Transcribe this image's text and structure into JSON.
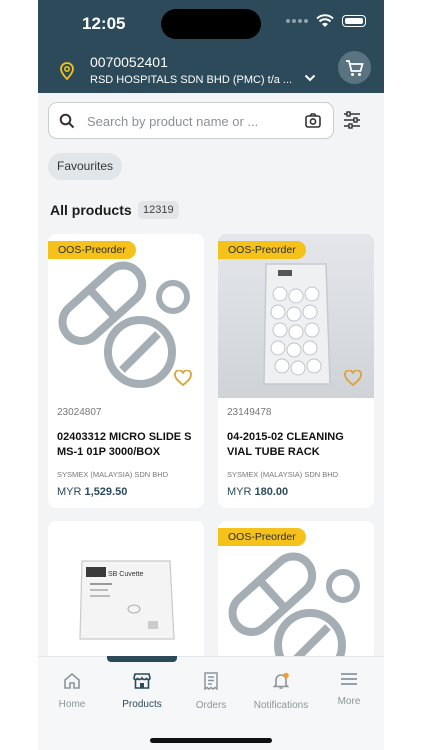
{
  "status_bar": {
    "time": "12:05"
  },
  "account": {
    "number": "0070052401",
    "name": "RSD HOSPITALS SDN BHD (PMC)  t/a ..."
  },
  "search": {
    "placeholder": "Search by product name or ..."
  },
  "filters": {
    "favourites_label": "Favourites"
  },
  "products": {
    "heading": "All products",
    "count": "12319"
  },
  "cards": [
    {
      "badge": "OOS-Preorder",
      "sku": "23024807",
      "name": "02403312 MICRO SLIDE S MS-1 01P 3000/BOX",
      "vendor": "SYSMEX (MALAYSIA) SDN BHD",
      "currency": "MYR",
      "price": "1,529.50"
    },
    {
      "badge": "OOS-Preorder",
      "sku": "23149478",
      "name": "04-2015-02 CLEANING VIAL TUBE RACK",
      "vendor": "SYSMEX (MALAYSIA) SDN BHD",
      "currency": "MYR",
      "price": "180.00"
    },
    {
      "badge": "",
      "sku": "",
      "name": "",
      "vendor": "",
      "currency": "",
      "price": "",
      "box_label": "SB Cuvette"
    },
    {
      "badge": "OOS-Preorder",
      "sku": "",
      "name": "",
      "vendor": "",
      "currency": "",
      "price": ""
    }
  ],
  "tabs": [
    {
      "label": "Home"
    },
    {
      "label": "Products"
    },
    {
      "label": "Orders"
    },
    {
      "label": "Notifications"
    },
    {
      "label": "More"
    }
  ],
  "colors": {
    "header": "#2c4a5a",
    "badge": "#f5c21b",
    "heart": "#d9a43b",
    "placeholder_icon": "#a5aeb5"
  }
}
